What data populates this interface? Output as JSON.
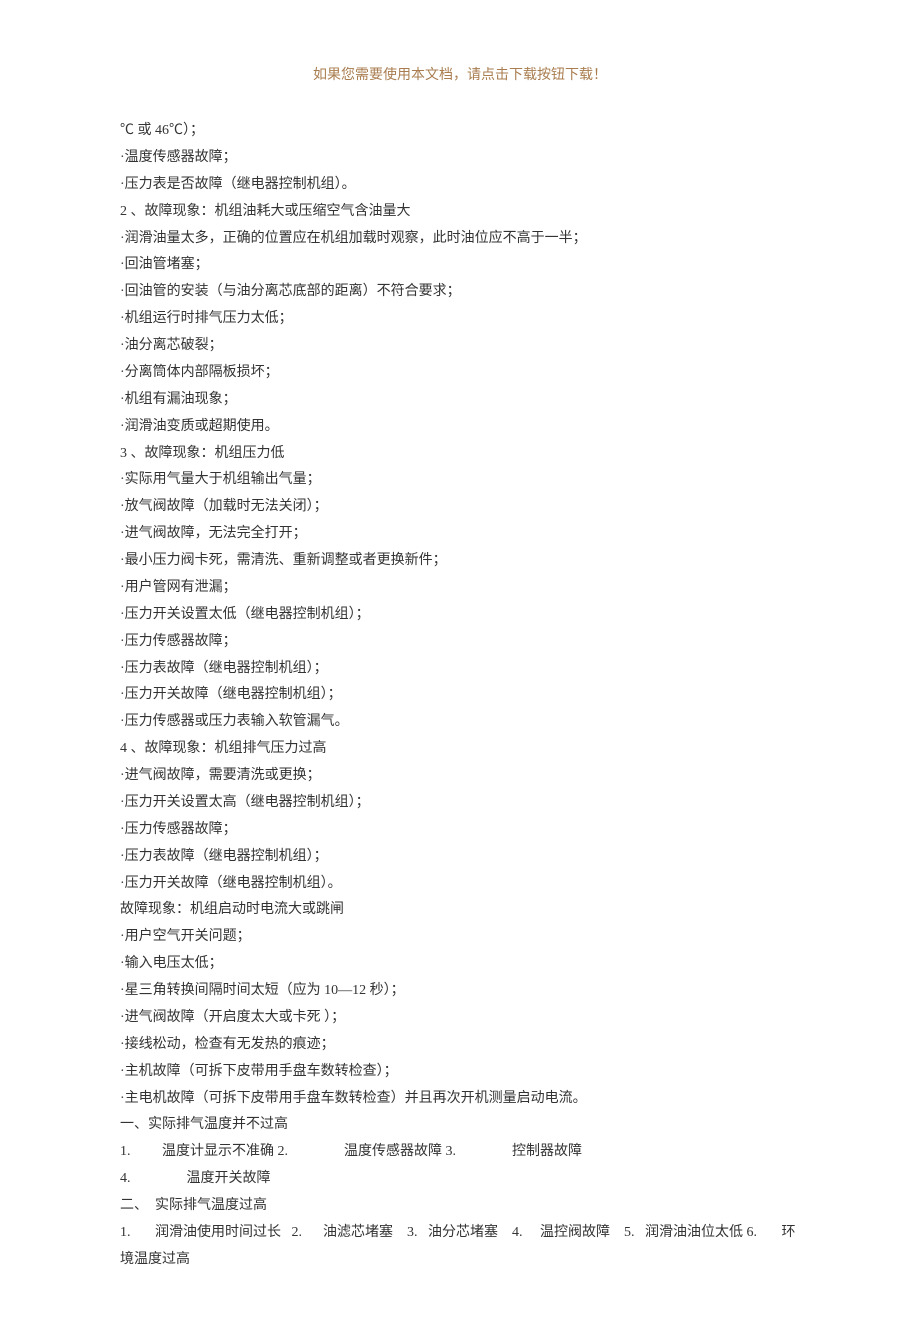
{
  "header": "如果您需要使用本文档，请点击下载按钮下载！",
  "lines": [
    "℃ 或 46℃）；",
    "·温度传感器故障；",
    "·压力表是否故障（继电器控制机组）。",
    "2 、故障现象：机组油耗大或压缩空气含油量大",
    "·润滑油量太多，正确的位置应在机组加载时观察，此时油位应不高于一半；",
    "·回油管堵塞；",
    "·回油管的安装（与油分离芯底部的距离）不符合要求；",
    "·机组运行时排气压力太低；",
    "·油分离芯破裂；",
    "·分离筒体内部隔板损坏；",
    "·机组有漏油现象；",
    "·润滑油变质或超期使用。",
    "3 、故障现象：机组压力低",
    "·实际用气量大于机组输出气量；",
    "·放气阀故障（加载时无法关闭）；",
    "·进气阀故障，无法完全打开；",
    "·最小压力阀卡死，需清洗、重新调整或者更换新件；",
    "·用户管网有泄漏；",
    "·压力开关设置太低（继电器控制机组）；",
    "·压力传感器故障；",
    "·压力表故障（继电器控制机组）；",
    "·压力开关故障（继电器控制机组）；",
    "·压力传感器或压力表输入软管漏气。",
    "4 、故障现象：机组排气压力过高",
    "·进气阀故障，需要清洗或更换；",
    "·压力开关设置太高（继电器控制机组）；",
    "·压力传感器故障；",
    "·压力表故障（继电器控制机组）；",
    "·压力开关故障（继电器控制机组）。",
    "故障现象：机组启动时电流大或跳闸",
    "·用户空气开关问题；",
    "·输入电压太低；",
    "·星三角转换间隔时间太短（应为 10—12 秒）；",
    "·进气阀故障（开启度太大或卡死 ）；",
    "·接线松动，检查有无发热的痕迹；",
    "·主机故障（可拆下皮带用手盘车数转检查）；",
    "·主电机故障（可拆下皮带用手盘车数转检查）并且再次开机测量启动电流。",
    "一、实际排气温度并不过高",
    "1.         温度计显示不准确 2.                温度传感器故障 3.                控制器故障       ",
    "4.                温度开关故障",
    "二、  实际排气温度过高",
    "1.       润滑油使用时间过长   2.      油滤芯堵塞    3.   油分芯堵塞    4.     温控阀故障    5.   润滑油油位太低 6.       环境温度过高"
  ]
}
